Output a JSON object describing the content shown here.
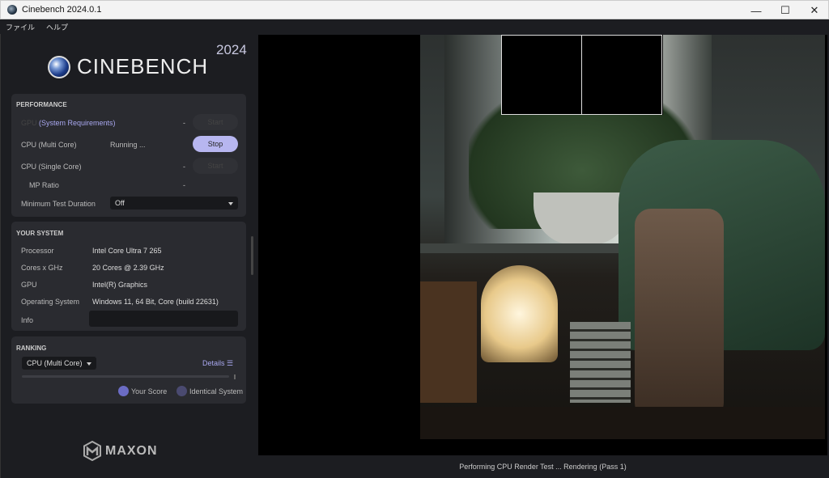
{
  "window": {
    "title": "Cinebench 2024.0.1",
    "minimize": "—",
    "maximize": "☐",
    "close": "✕"
  },
  "menu": [
    "ファイル",
    "ヘルプ"
  ],
  "brand": {
    "name": "CINEBENCH",
    "year": "2024",
    "footer": "MAXON"
  },
  "performance": {
    "heading": "PERFORMANCE",
    "gpu": {
      "label": "GPU",
      "link": "(System Requirements)",
      "value": "-",
      "button": "Start"
    },
    "multi": {
      "label": "CPU (Multi Core)",
      "value": "Running ...",
      "button": "Stop"
    },
    "single": {
      "label": "CPU (Single Core)",
      "value": "-",
      "button": "Start"
    },
    "mp": {
      "label": "MP Ratio",
      "value": "-"
    },
    "duration": {
      "label": "Minimum Test Duration",
      "value": "Off"
    }
  },
  "system": {
    "heading": "YOUR SYSTEM",
    "rows": [
      {
        "label": "Processor",
        "value": "Intel Core Ultra 7 265"
      },
      {
        "label": "Cores x GHz",
        "value": "20 Cores @ 2.39 GHz"
      },
      {
        "label": "GPU",
        "value": "Intel(R) Graphics"
      },
      {
        "label": "Operating System",
        "value": "Windows 11, 64 Bit, Core (build 22631)"
      }
    ],
    "info_label": "Info",
    "info_value": ""
  },
  "ranking": {
    "heading": "RANKING",
    "select": "CPU (Multi Core)",
    "details": "Details",
    "legend": [
      "Your Score",
      "Identical System"
    ],
    "colors": [
      "#6b6cc4",
      "#4a4a70"
    ]
  },
  "status": "Performing CPU Render Test ... Rendering (Pass 1)"
}
